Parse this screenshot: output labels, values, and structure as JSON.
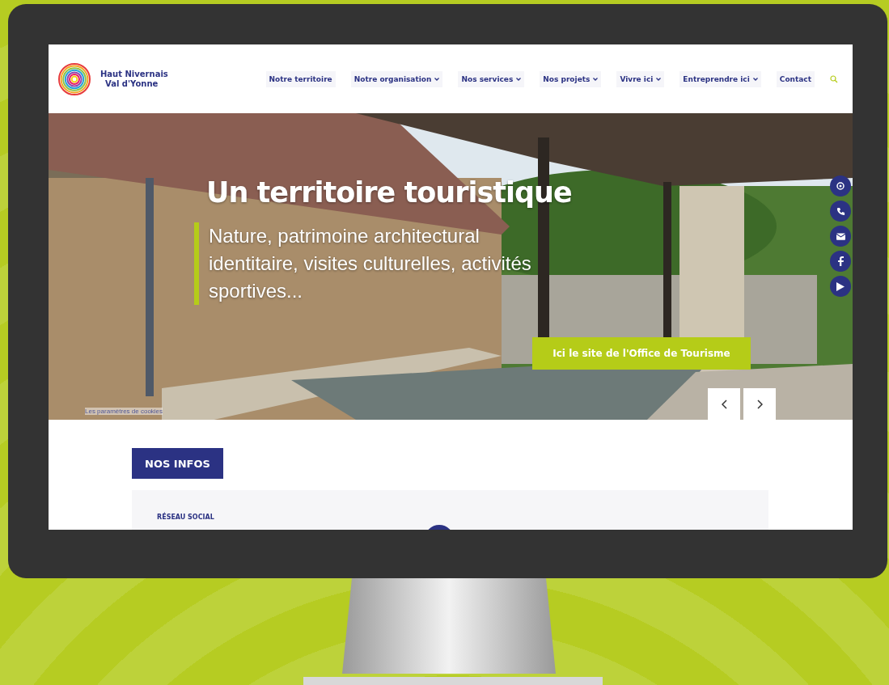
{
  "site": {
    "logo": {
      "line_1": "Haut Nivernais",
      "line_2": "Val d'Yonne"
    },
    "nav": [
      {
        "label": "Notre territoire",
        "dropdown": false
      },
      {
        "label": "Notre organisation",
        "dropdown": true
      },
      {
        "label": "Nos services",
        "dropdown": true
      },
      {
        "label": "Nos projets",
        "dropdown": true
      },
      {
        "label": "Vivre ici",
        "dropdown": true
      },
      {
        "label": "Entreprendre ici",
        "dropdown": true
      },
      {
        "label": "Contact",
        "dropdown": false
      }
    ]
  },
  "hero": {
    "kind": "picture",
    "title": "Un territoire touristique",
    "subtitle": "Nature, patrimoine architectural identitaire, visites culturelles, activités sportives...",
    "cta": "Ici le site de l'Office de Tourisme",
    "caption": "Les paramètres de cookies"
  },
  "social": [
    {
      "kind": "accessibility"
    },
    {
      "kind": "phone"
    },
    {
      "kind": "mail"
    },
    {
      "kind": "facebook"
    },
    {
      "kind": "video"
    }
  ],
  "infos": {
    "heading": "NOS INFOS",
    "card_label": "RÉSEAU SOCIAL"
  }
}
